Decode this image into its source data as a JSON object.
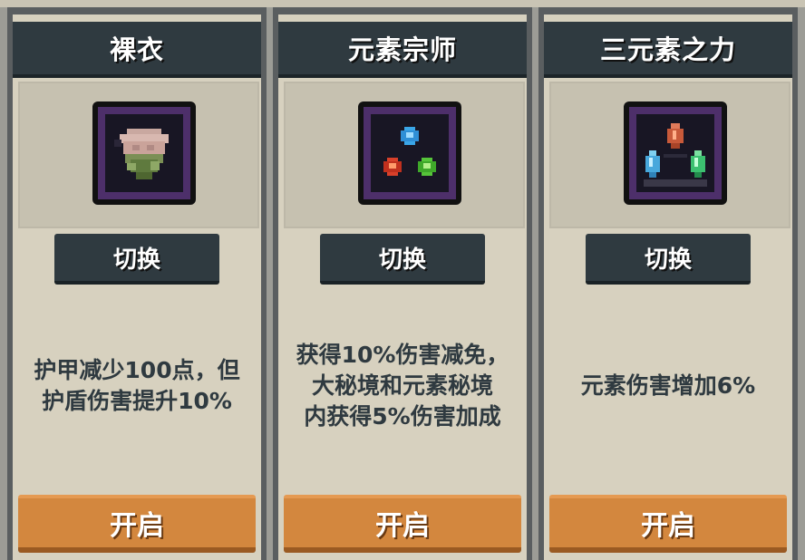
{
  "cards": [
    {
      "title": "裸衣",
      "icon": "robe-icon",
      "switch_label": "切换",
      "description": "护甲减少100点，但\n护盾伤害提升10%",
      "open_label": "开启"
    },
    {
      "title": "元素宗师",
      "icon": "elemental-orbs-icon",
      "switch_label": "切换",
      "description": "获得10%伤害减免，\n大秘境和元素秘境\n内获得5%伤害加成",
      "open_label": "开启"
    },
    {
      "title": "三元素之力",
      "icon": "three-crystals-icon",
      "switch_label": "切换",
      "description": "元素伤害增加6%",
      "open_label": "开启"
    }
  ],
  "colors": {
    "header_bg": "#2f3a40",
    "card_bg": "#d7d1bf",
    "open_button": "#d3873e",
    "text_dark": "#2f3a40",
    "icon_frame": "#4d2f6a"
  }
}
